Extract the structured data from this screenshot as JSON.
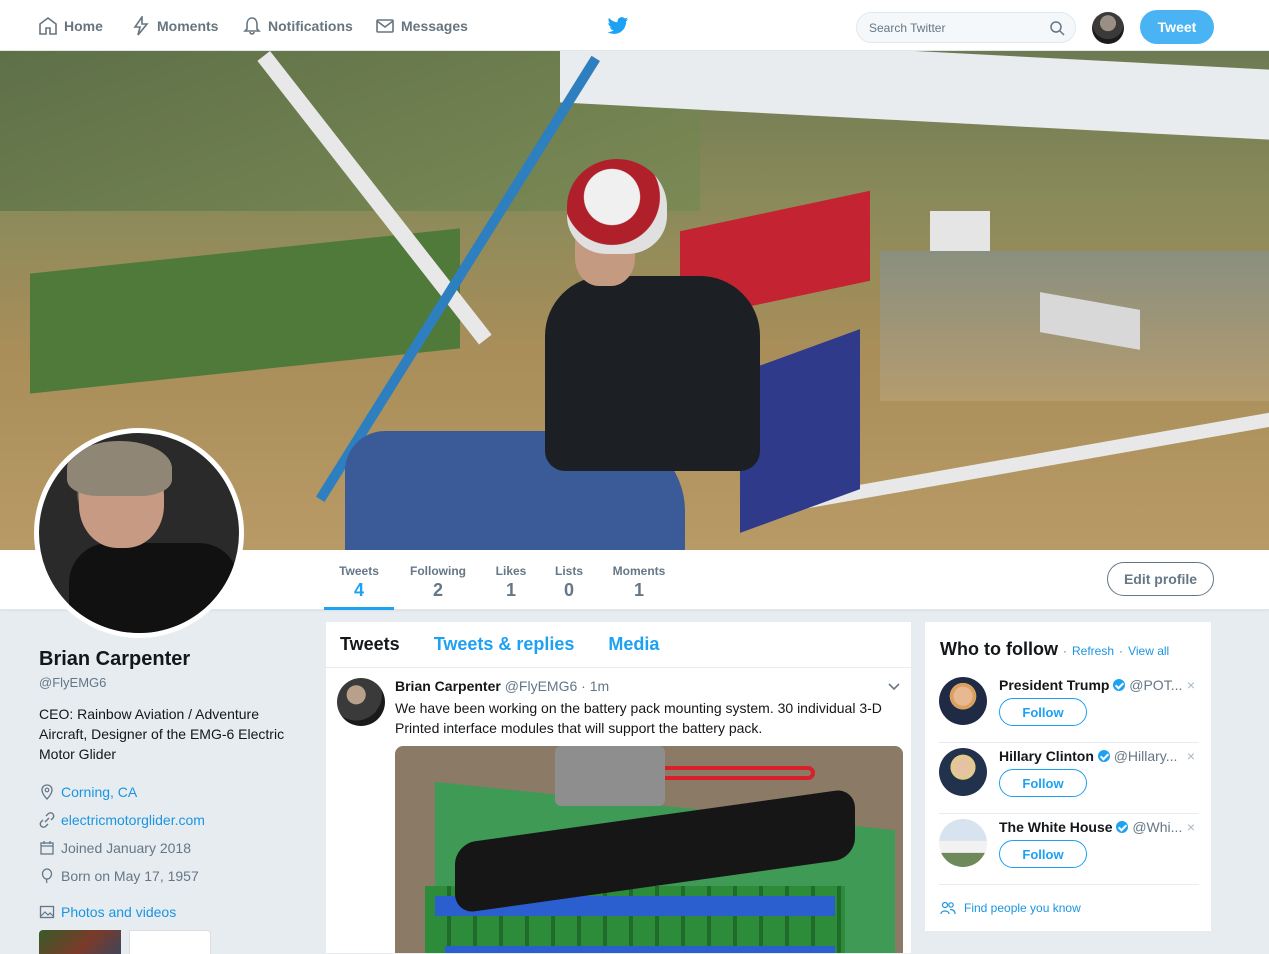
{
  "nav": {
    "home": "Home",
    "moments": "Moments",
    "notifications": "Notifications",
    "messages": "Messages",
    "search_placeholder": "Search Twitter",
    "tweet_button": "Tweet"
  },
  "profile": {
    "name": "Brian Carpenter",
    "handle": "@FlyEMG6",
    "bio": "CEO: Rainbow Aviation / Adventure Aircraft, Designer of the EMG-6 Electric Motor Glider",
    "location": "Corning, CA",
    "website": "electricmotorglider.com",
    "joined": "Joined January 2018",
    "born": "Born on May 17, 1957",
    "photos_link": "Photos and videos",
    "edit_button": "Edit profile"
  },
  "stats": [
    {
      "label": "Tweets",
      "value": "4"
    },
    {
      "label": "Following",
      "value": "2"
    },
    {
      "label": "Likes",
      "value": "1"
    },
    {
      "label": "Lists",
      "value": "0"
    },
    {
      "label": "Moments",
      "value": "1"
    }
  ],
  "timeline": {
    "tabs": [
      "Tweets",
      "Tweets & replies",
      "Media"
    ],
    "tweet": {
      "name": "Brian Carpenter",
      "handle": "@FlyEMG6",
      "time": "· 1m",
      "text": "We have been working on the battery pack mounting system. 30 individual 3-D Printed interface modules that will support the battery pack."
    }
  },
  "who_to_follow": {
    "title": "Who to follow",
    "refresh": "Refresh",
    "view_all": "View all",
    "separator": "·",
    "follow_label": "Follow",
    "close": "×",
    "suggestions": [
      {
        "name": "President Trump",
        "handle": "@POT..."
      },
      {
        "name": "Hillary Clinton",
        "handle": "@Hillary..."
      },
      {
        "name": "The White House",
        "handle": "@Whi..."
      }
    ],
    "find_people": "Find people you know"
  },
  "colors": {
    "accent": "#1da1f2",
    "tweet_button": "#4ab3f4",
    "link": "#1b95e0"
  }
}
